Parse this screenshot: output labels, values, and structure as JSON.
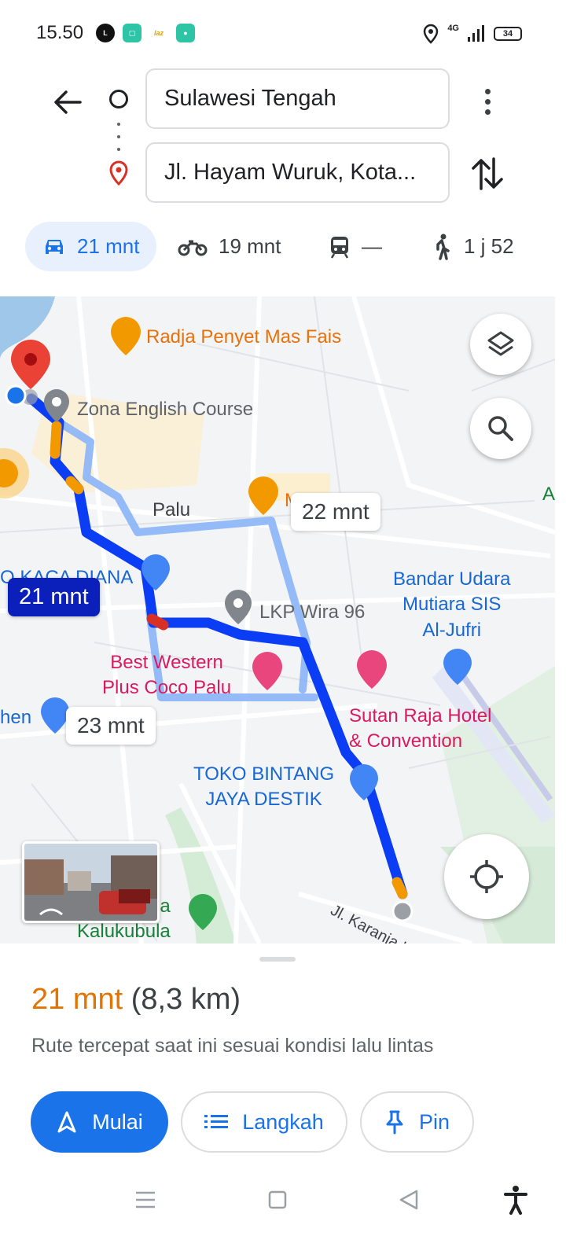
{
  "status_bar": {
    "time": "15.50",
    "network": "4G",
    "battery": "34",
    "left_icons": [
      "line-app-icon",
      "gallery-app-icon",
      "lazada-app-icon",
      "chat-app-icon"
    ]
  },
  "directions": {
    "origin": "Sulawesi Tengah",
    "destination": "Jl. Hayam Wuruk, Kota..."
  },
  "modes": [
    {
      "name": "car",
      "label": "21 mnt",
      "active": true
    },
    {
      "name": "motorcycle",
      "label": "19 mnt"
    },
    {
      "name": "transit",
      "label": "—"
    },
    {
      "name": "walk",
      "label": "1 j 52"
    }
  ],
  "map": {
    "pois": [
      {
        "name": "Radja Penyet Mas Fais",
        "color": "orange"
      },
      {
        "name": "Zona English Course",
        "color": "gray"
      },
      {
        "name": "Palu",
        "color": "dark"
      },
      {
        "name": "M",
        "color": "orange"
      },
      {
        "name": "O KACA DIANA",
        "color": "blue"
      },
      {
        "name": "LKP Wira 96",
        "color": "gray"
      },
      {
        "name": "Best Western\nPlus Coco Palu",
        "color": "pink"
      },
      {
        "name": "Bandar Udara\nMutiara SIS\nAl-Jufri",
        "color": "blue"
      },
      {
        "name": "Sutan Raja Hotel\n& Convention",
        "color": "pink"
      },
      {
        "name": "hen",
        "color": "blue"
      },
      {
        "name": "TOKO BINTANG\nJAYA DESTIK",
        "color": "blue"
      },
      {
        "name": "nja\nKalukubula",
        "color": "green"
      },
      {
        "name": "Jl. Karanja Lem",
        "color": "dark"
      },
      {
        "name": "A",
        "color": "green"
      }
    ],
    "route_bubbles": [
      {
        "label": "21 mnt",
        "selected": true
      },
      {
        "label": "22 mnt",
        "selected": false
      },
      {
        "label": "23 mnt",
        "selected": false
      }
    ]
  },
  "summary": {
    "time": "21 mnt",
    "distance": "(8,3 km)",
    "note": "Rute tercepat saat ini sesuai kondisi lalu lintas"
  },
  "actions": {
    "start": "Mulai",
    "steps": "Langkah",
    "pin": "Pin"
  },
  "colors": {
    "accent": "#1a73e8",
    "route_primary": "#0b3df5",
    "route_alt": "#8ab4f8",
    "traffic_slow": "#f29900",
    "traffic_jam": "#d93025",
    "eta_orange": "#e37400"
  }
}
